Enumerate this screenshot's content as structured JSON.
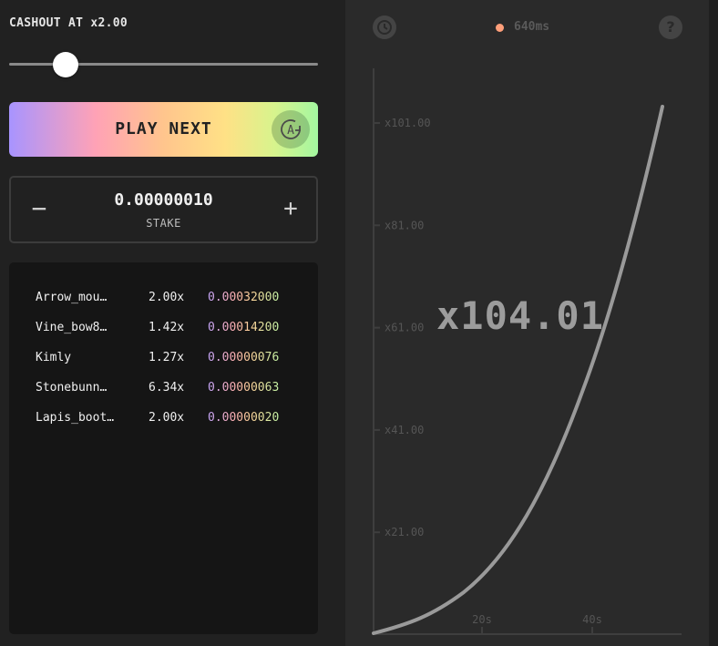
{
  "controls": {
    "cashout_label": "CASHOUT AT x2.00",
    "slider_value": 0.2,
    "play_label": "PLAY NEXT",
    "auto_icon_letter": "A",
    "stake_value": "0.00000010",
    "stake_label": "STAKE",
    "minus_label": "−",
    "plus_label": "+"
  },
  "bets": [
    {
      "name": "Arrow_mou…",
      "multiplier": "2.00x",
      "amount": "0.00032000"
    },
    {
      "name": "Vine_bow8…",
      "multiplier": "1.42x",
      "amount": "0.00014200"
    },
    {
      "name": "Kimly",
      "multiplier": "1.27x",
      "amount": "0.00000076"
    },
    {
      "name": "Stonebunn…",
      "multiplier": "6.34x",
      "amount": "0.00000063"
    },
    {
      "name": "Lapis_boot…",
      "multiplier": "2.00x",
      "amount": "0.00000020"
    }
  ],
  "graph_header": {
    "ping": "640ms",
    "ping_color": "#ff9f7a",
    "help_label": "?",
    "clock_icon": "clock-icon"
  },
  "chart_data": {
    "type": "line",
    "y_ticks": [
      "x101.00",
      "x81.00",
      "x61.00",
      "x41.00",
      "x21.00"
    ],
    "x_ticks": [
      "20s",
      "40s"
    ],
    "current_multiplier": "x104.01",
    "line_color": "#9a9a9a"
  }
}
